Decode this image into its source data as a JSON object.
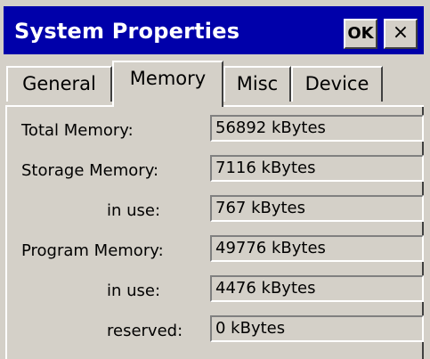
{
  "window": {
    "title": "System Properties",
    "ok_label": "OK",
    "close_label": "×"
  },
  "tabs": [
    {
      "label": "General",
      "active": false
    },
    {
      "label": "Memory",
      "active": true
    },
    {
      "label": "Misc",
      "active": false
    },
    {
      "label": "Device",
      "active": false
    }
  ],
  "memory": {
    "rows": [
      {
        "label": "Total Memory:",
        "value": "56892 kBytes"
      },
      {
        "label": "Storage Memory:",
        "value": "7116 kBytes"
      },
      {
        "label": "in use:",
        "value": "767 kBytes"
      },
      {
        "label": "Program Memory:",
        "value": "49776 kBytes"
      },
      {
        "label": "in use:",
        "value": "4476 kBytes"
      },
      {
        "label": "reserved:",
        "value": "0 kBytes"
      }
    ]
  },
  "colors": {
    "titlebar": "#0000aa",
    "face": "#d4d0c8"
  }
}
